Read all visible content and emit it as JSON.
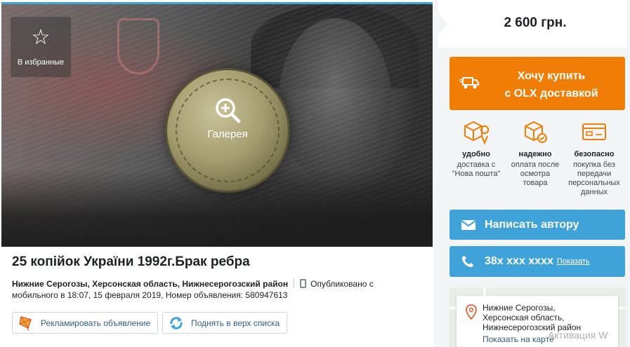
{
  "gallery": {
    "favorite_label": "В избранные",
    "gallery_label": "Галерея"
  },
  "ad": {
    "title": "25 копійок України 1992г.Брак ребра",
    "location": "Нижние Серогозы, Херсонская область, Нижнесерогозский район",
    "published_prefix": "Опубликовано с",
    "published_rest": "мобильного  в 18:07, 15 февраля 2019, Номер объявления: 580947613"
  },
  "actions": {
    "promote_label": "Рекламировать объявление",
    "bump_label": "Поднять в верх списка"
  },
  "sidebar": {
    "price": "2 600 грн.",
    "buy_line1": "Хочу купить",
    "buy_line2": "с OLX доставкой",
    "features": [
      {
        "icon": "box-location-icon",
        "title": "удобно",
        "desc": "доставка с \"Нова пошта\""
      },
      {
        "icon": "box-check-icon",
        "title": "надежно",
        "desc": "оплата после осмотра товара"
      },
      {
        "icon": "card-icon",
        "title": "безопасно",
        "desc": "покупка без передачи персональных данных"
      }
    ],
    "message_label": "Написать автору",
    "phone_label": "38x xxx xxxx",
    "phone_show": "Показать",
    "map_address_line1": "Нижние Серогозы,",
    "map_address_line2": "Херсонская область,",
    "map_address_line3": "Нижнесерогозский район",
    "map_link": "Показать на карте",
    "watermark": "Активация W"
  },
  "colors": {
    "accent_orange": "#f07d06",
    "accent_blue": "#3fa2d8",
    "link_blue": "#2f5b83"
  }
}
